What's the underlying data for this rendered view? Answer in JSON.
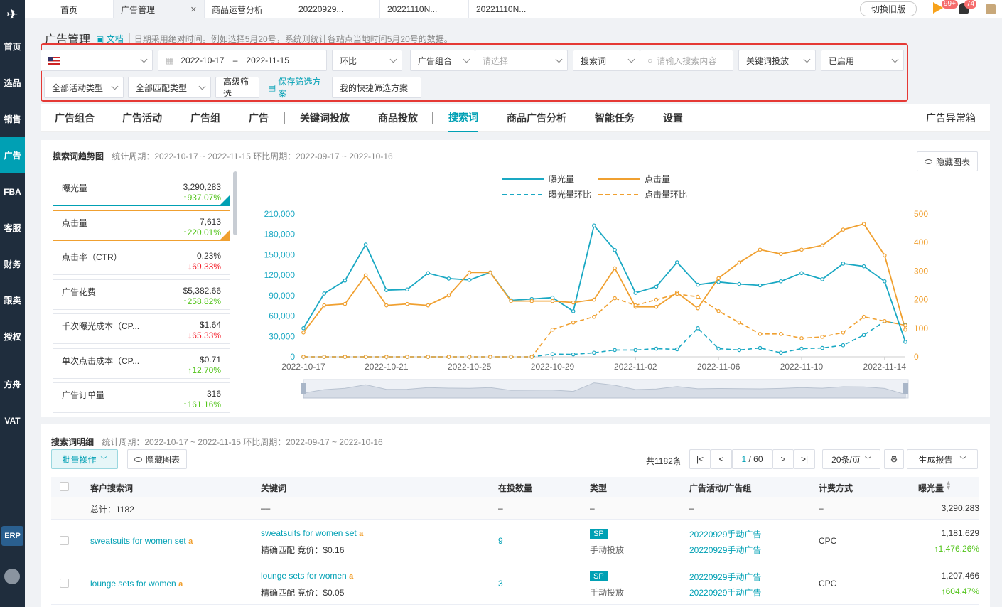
{
  "sidebar": {
    "items": [
      {
        "label": "首页",
        "active": false
      },
      {
        "label": "选品",
        "active": false
      },
      {
        "label": "销售",
        "active": false
      },
      {
        "label": "广告",
        "active": true
      },
      {
        "label": "FBA",
        "active": false
      },
      {
        "label": "客服",
        "active": false
      },
      {
        "label": "财务",
        "active": false
      },
      {
        "label": "跟卖",
        "active": false
      },
      {
        "label": "授权",
        "active": false
      },
      {
        "label": "方舟",
        "active": false
      },
      {
        "label": "VAT",
        "active": false
      }
    ],
    "erp": "ERP"
  },
  "tabs": [
    {
      "label": "首页"
    },
    {
      "label": "广告管理"
    },
    {
      "label": "商品运营分析"
    },
    {
      "label": "20220929..."
    },
    {
      "label": "20221110N..."
    },
    {
      "label": "20221110N..."
    }
  ],
  "topbar": {
    "switch_old": "切换旧版",
    "badge1": "99+",
    "badge2": "74"
  },
  "header": {
    "title": "广告管理",
    "doc": "文档",
    "hint": "日期采用绝对时间。例如选择5月20号，系统则统计各站点当地时间5月20号的数据。"
  },
  "filters": {
    "date_start": "2022-10-17",
    "date_sep": "–",
    "date_end": "2022-11-15",
    "compare": "环比",
    "group": "广告组合",
    "group_ph": "请选择",
    "search_type": "搜索词",
    "search_ph": "请输入搜索内容",
    "keyword_type": "关键词投放",
    "status": "已启用",
    "activity_type": "全部活动类型",
    "match_type": "全部匹配类型",
    "advanced": "高级筛选",
    "save_plan": "保存筛选方案",
    "my_plans": "我的快捷筛选方案"
  },
  "navtabs": {
    "items": [
      "广告组合",
      "广告活动",
      "广告组",
      "广告",
      "关键词投放",
      "商品投放",
      "搜索词",
      "商品广告分析",
      "智能任务",
      "设置"
    ],
    "active": "搜索词",
    "right": "广告异常箱"
  },
  "trend": {
    "title": "搜索词趋势图",
    "period": "统计周期：2022-10-17 ~ 2022-11-15 环比周期：2022-09-17 ~ 2022-10-16",
    "hide_chart": "隐藏图表"
  },
  "metrics": [
    {
      "label": "曝光量",
      "value": "3,290,283",
      "delta": "↑937.07%",
      "dir": "up"
    },
    {
      "label": "点击量",
      "value": "7,613",
      "delta": "↑220.01%",
      "dir": "up"
    },
    {
      "label": "点击率（CTR）",
      "value": "0.23%",
      "delta": "↓69.33%",
      "dir": "down"
    },
    {
      "label": "广告花费",
      "value": "$5,382.66",
      "delta": "↑258.82%",
      "dir": "up"
    },
    {
      "label": "千次曝光成本（CP...",
      "value": "$1.64",
      "delta": "↓65.33%",
      "dir": "down"
    },
    {
      "label": "单次点击成本（CP...",
      "value": "$0.71",
      "delta": "↑12.70%",
      "dir": "up"
    },
    {
      "label": "广告订单量",
      "value": "316",
      "delta": "↑161.16%",
      "dir": "up"
    }
  ],
  "chart_data": {
    "type": "line",
    "x": [
      "2022-10-17",
      "2022-10-18",
      "2022-10-19",
      "2022-10-20",
      "2022-10-21",
      "2022-10-22",
      "2022-10-23",
      "2022-10-24",
      "2022-10-25",
      "2022-10-26",
      "2022-10-27",
      "2022-10-28",
      "2022-10-29",
      "2022-10-30",
      "2022-10-31",
      "2022-11-01",
      "2022-11-02",
      "2022-11-03",
      "2022-11-04",
      "2022-11-05",
      "2022-11-06",
      "2022-11-07",
      "2022-11-08",
      "2022-11-09",
      "2022-11-10",
      "2022-11-11",
      "2022-11-12",
      "2022-11-13",
      "2022-11-14",
      "2022-11-15"
    ],
    "x_ticks": [
      "2022-10-17",
      "2022-10-21",
      "2022-10-25",
      "2022-10-29",
      "2022-11-02",
      "2022-11-06",
      "2022-11-10",
      "2022-11-14"
    ],
    "y_left": {
      "min": 0,
      "max": 210000,
      "ticks": [
        "0",
        "30,000",
        "60,000",
        "90,000",
        "120,000",
        "150,000",
        "180,000",
        "210,000"
      ]
    },
    "y_right": {
      "min": 0,
      "max": 500,
      "ticks": [
        "0",
        "100",
        "200",
        "300",
        "400",
        "500"
      ]
    },
    "series": [
      {
        "name": "曝光量",
        "axis": "left",
        "style": "solid",
        "color": "#1aa8c3",
        "values": [
          42000,
          93000,
          112000,
          165000,
          98000,
          99000,
          123000,
          115000,
          113000,
          124000,
          83000,
          85000,
          87000,
          67000,
          193000,
          157000,
          94000,
          103000,
          139000,
          106000,
          110000,
          107000,
          105000,
          111000,
          123000,
          114000,
          137000,
          133000,
          111000,
          22000
        ]
      },
      {
        "name": "点击量",
        "axis": "right",
        "style": "solid",
        "color": "#f0a030",
        "values": [
          85,
          180,
          185,
          285,
          180,
          185,
          180,
          215,
          295,
          295,
          195,
          195,
          195,
          190,
          200,
          310,
          175,
          175,
          225,
          170,
          275,
          330,
          375,
          360,
          375,
          390,
          445,
          465,
          355,
          95
        ]
      },
      {
        "name": "曝光量环比",
        "axis": "left",
        "style": "dashed",
        "color": "#1aa8c3",
        "values": [
          0,
          0,
          0,
          0,
          0,
          0,
          0,
          0,
          0,
          0,
          0,
          0,
          4000,
          3500,
          6000,
          10000,
          10000,
          12000,
          11000,
          42000,
          12000,
          10000,
          13000,
          6000,
          12000,
          13000,
          17000,
          32000,
          52000,
          47000
        ]
      },
      {
        "name": "点击量环比",
        "axis": "right",
        "style": "dashed",
        "color": "#f0a030",
        "values": [
          0,
          0,
          0,
          0,
          0,
          0,
          0,
          0,
          0,
          0,
          0,
          0,
          95,
          120,
          140,
          205,
          180,
          200,
          220,
          210,
          160,
          120,
          80,
          80,
          65,
          70,
          85,
          140,
          125,
          110
        ]
      }
    ]
  },
  "detail": {
    "title": "搜索词明细",
    "period": "统计周期：2022-10-17 ~ 2022-11-15 环比周期：2022-09-17 ~ 2022-10-16",
    "bulk": "批量操作",
    "hide_chart": "隐藏图表",
    "total": "共1182条",
    "page": "1",
    "pages": "/ 60",
    "page_size": "20条/页",
    "report": "生成报告",
    "columns": [
      "客户搜索词",
      "关键词",
      "在投数量",
      "类型",
      "广告活动/广告组",
      "计费方式",
      "曝光量"
    ],
    "summary": {
      "label": "总计：1182",
      "keyword": "––",
      "count": "–",
      "type": "–",
      "campaign": "–",
      "billing": "–",
      "impressions": "3,290,283"
    },
    "rows": [
      {
        "term": "sweatsuits for women set",
        "keyword": "sweatsuits for women set",
        "match": "精确匹配  竞价：$0.16",
        "count": "9",
        "type_tag": "SP",
        "type_sub": "手动投放",
        "campaign": "20220929手动广告",
        "group": "20220929手动广告",
        "billing": "CPC",
        "impressions": "1,181,629",
        "delta": "↑1,476.26%"
      },
      {
        "term": "lounge sets for women",
        "keyword": "lounge sets for women",
        "match": "精确匹配  竞价：$0.05",
        "count": "3",
        "type_tag": "SP",
        "type_sub": "手动投放",
        "campaign": "20220929手动广告",
        "group": "20220929手动广告",
        "billing": "CPC",
        "impressions": "1,207,466",
        "delta": "↑604.47%"
      }
    ]
  }
}
